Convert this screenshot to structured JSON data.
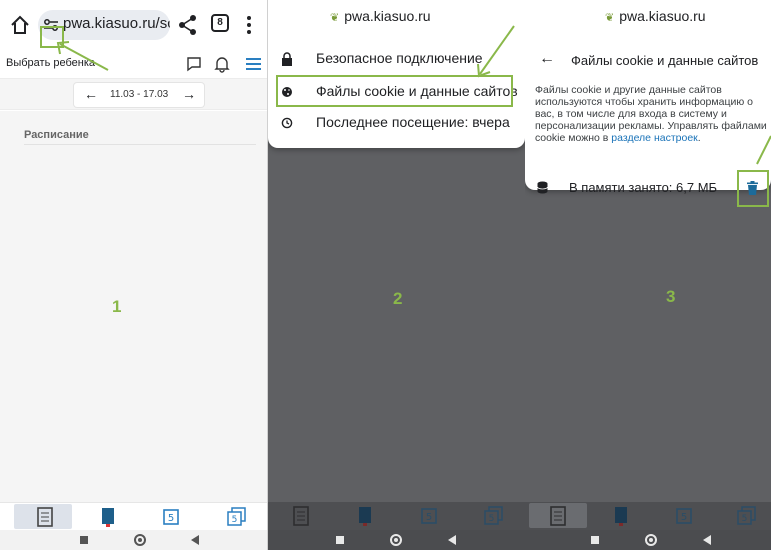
{
  "panel1": {
    "browser": {
      "url": "pwa.kiasuo.ru/scl",
      "tabs_count": "8"
    },
    "site_header": {
      "select_child": "Выбрать ребенка"
    },
    "week": {
      "range": "11.03 - 17.03",
      "prev": "←",
      "next": "→"
    },
    "schedule": {
      "title": "Расписание"
    },
    "number": "1"
  },
  "panel2": {
    "host": "pwa.kiasuo.ru",
    "menu": [
      {
        "label": "Безопасное подключение",
        "icon": "lock-icon"
      },
      {
        "label": "Файлы cookie и данные сайтов",
        "icon": "cookie-icon"
      },
      {
        "label": "Последнее посещение: вчера",
        "icon": "history-icon"
      }
    ],
    "number": "2"
  },
  "panel3": {
    "host": "pwa.kiasuo.ru",
    "title": "Файлы cookie и данные сайтов",
    "back": "←",
    "description_pre": "Файлы cookie и другие данные сайтов используются чтобы хранить информацию о вас, в том числе для входа в систему и персонализации рекламы. Управлять файлами cookie можно в ",
    "description_link": "разделе настроек",
    "description_post": ".",
    "storage": "В памяти занято: 6,7 МБ",
    "number": "3"
  },
  "colors": {
    "highlight": "#8ab84a",
    "overlay": "#5f6063",
    "link": "#1a73b8",
    "trash": "#1c6b9a"
  }
}
